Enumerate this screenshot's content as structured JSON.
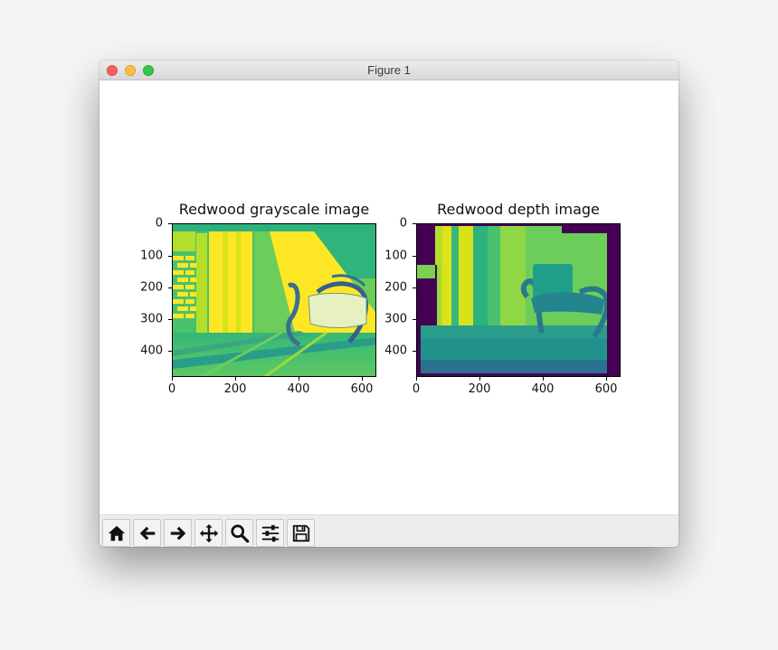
{
  "window": {
    "title": "Figure 1"
  },
  "figure": {
    "left_axes": {
      "title": "Redwood grayscale image",
      "x_ticks": [
        "0",
        "200",
        "400",
        "600"
      ],
      "y_ticks": [
        "0",
        "100",
        "200",
        "300",
        "400"
      ]
    },
    "right_axes": {
      "title": "Redwood depth image",
      "x_ticks": [
        "0",
        "200",
        "400",
        "600"
      ],
      "y_ticks": [
        "0",
        "100",
        "200",
        "300",
        "400"
      ]
    }
  },
  "toolbar": {
    "buttons": [
      {
        "name": "home-button",
        "icon": "home-icon"
      },
      {
        "name": "back-button",
        "icon": "arrow-left-icon"
      },
      {
        "name": "forward-button",
        "icon": "arrow-right-icon"
      },
      {
        "name": "pan-button",
        "icon": "move-icon"
      },
      {
        "name": "zoom-button",
        "icon": "magnifier-icon"
      },
      {
        "name": "configure-subplots-button",
        "icon": "sliders-icon"
      },
      {
        "name": "save-button",
        "icon": "floppy-disk-icon"
      }
    ]
  },
  "colors": {
    "viridis_dark": "#440154",
    "viridis_teal": "#21918c",
    "viridis_green": "#5ec962",
    "viridis_yellow": "#fde725"
  }
}
